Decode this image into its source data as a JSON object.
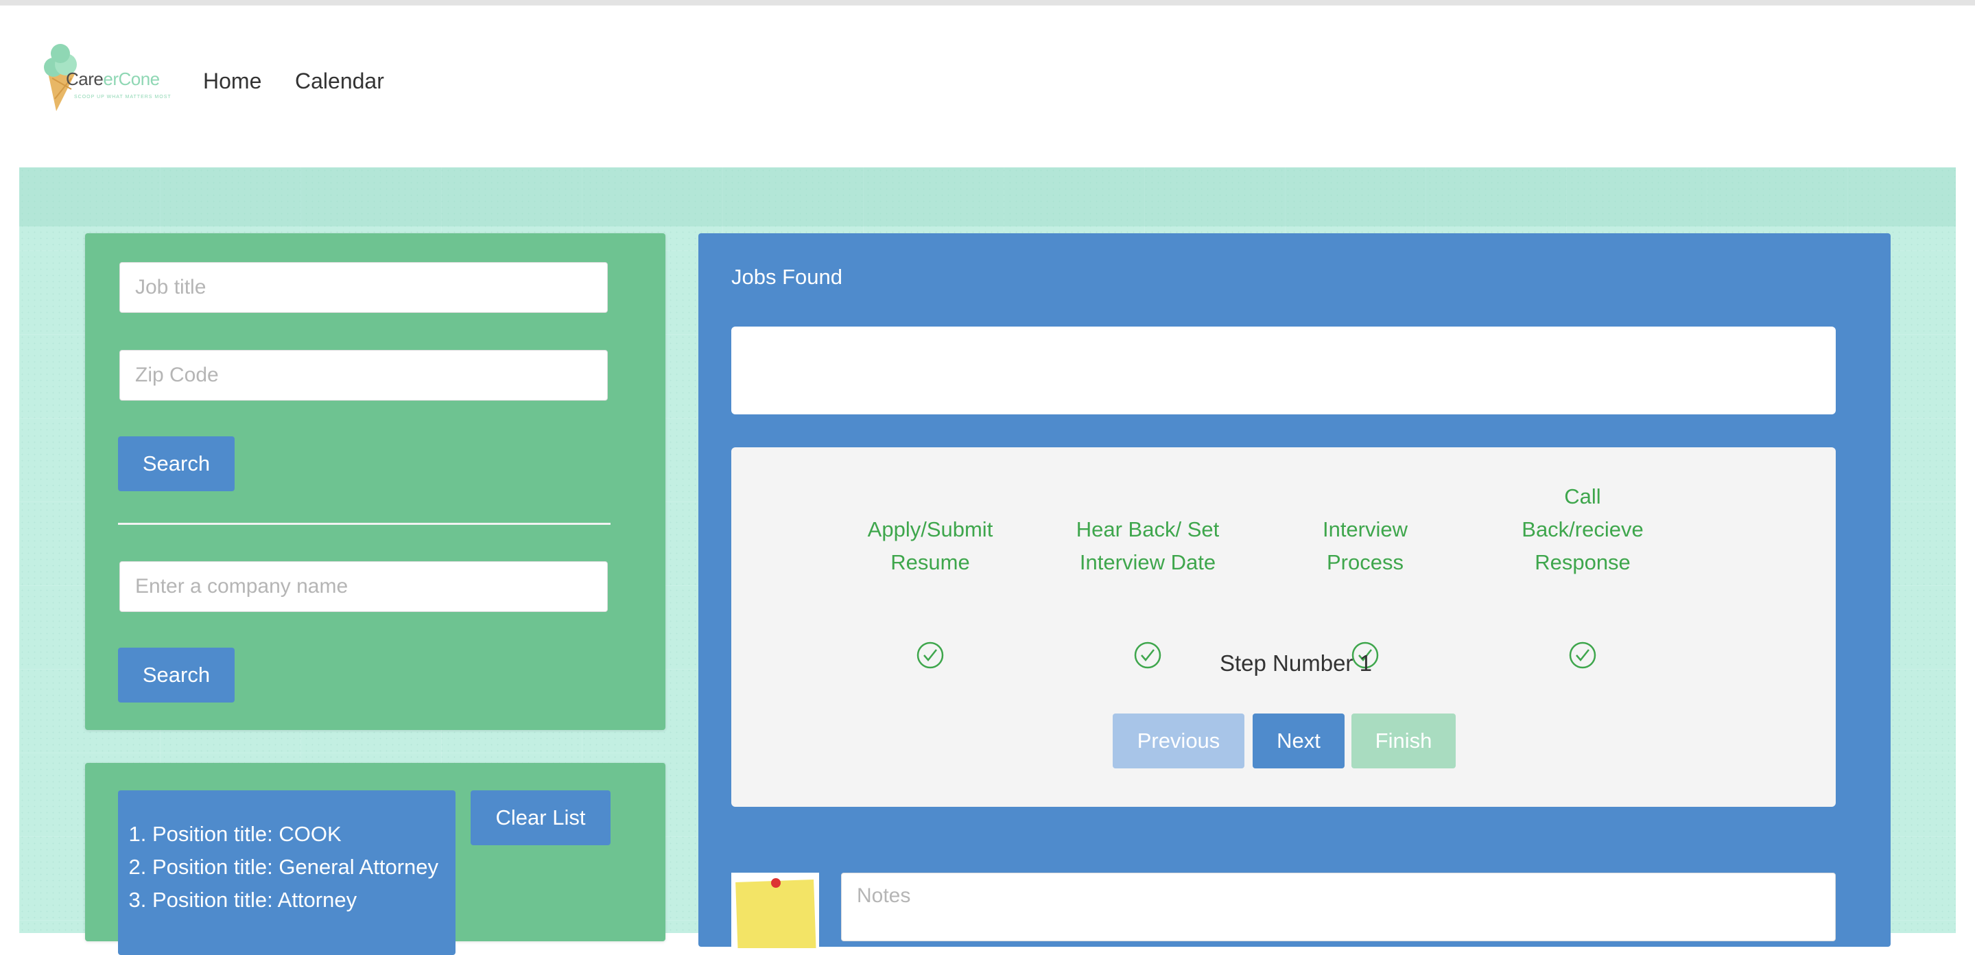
{
  "app": {
    "logo_text_part1": "Care",
    "logo_text_part2": "erCone",
    "logo_tagline": "SCOOP UP WHAT MATTERS MOST"
  },
  "nav": {
    "home": "Home",
    "calendar": "Calendar"
  },
  "search_panel": {
    "job_title_placeholder": "Job title",
    "zip_placeholder": "Zip Code",
    "search_button": "Search",
    "company_placeholder": "Enter a company name",
    "company_search_button": "Search"
  },
  "saved_list": {
    "items": [
      "Position title: COOK",
      "Position title: General Attorney",
      "Position title: Attorney"
    ],
    "clear_button": "Clear List"
  },
  "jobs_panel": {
    "title": "Jobs Found",
    "steps": [
      "Apply/Submit Resume",
      "Hear Back/ Set Interview Date",
      "Interview Process",
      "Call Back/recieve Response"
    ],
    "step_number_text": "Step Number 1",
    "previous_button": "Previous",
    "next_button": "Next",
    "finish_button": "Finish",
    "notes_placeholder": "Notes"
  },
  "colors": {
    "panel_green": "#6ec391",
    "panel_blue": "#4f8bcc",
    "step_green": "#3ea64c",
    "hero_background": "#c3efe2"
  },
  "icons": {
    "step_check": "check-circle-icon",
    "logo": "ice-cream-cone-icon",
    "sticky_note": "sticky-note-icon"
  }
}
